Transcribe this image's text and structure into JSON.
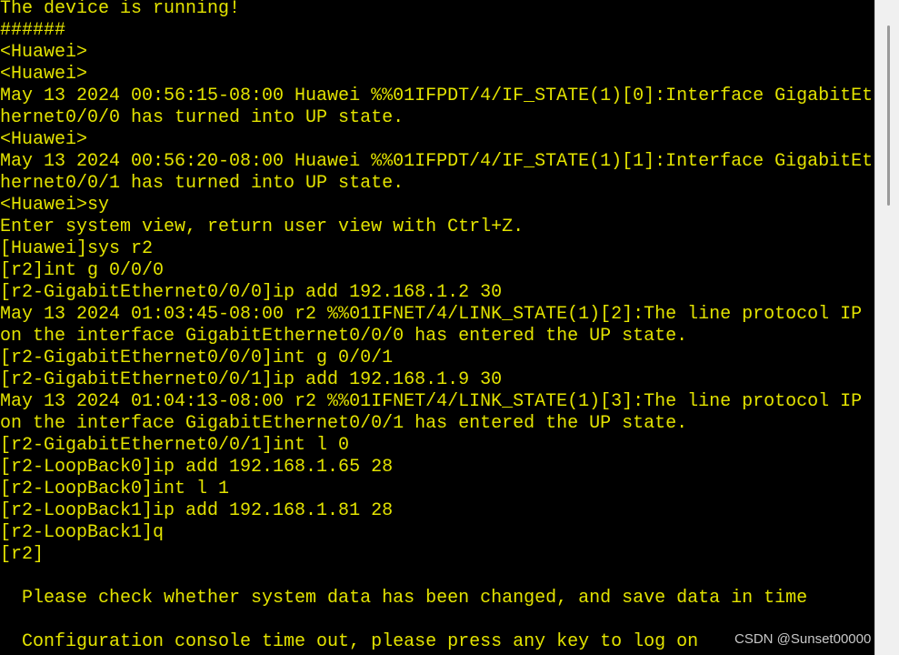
{
  "terminal": {
    "lines": [
      "The device is running!",
      "######",
      "<Huawei>",
      "<Huawei>",
      "May 13 2024 00:56:15-08:00 Huawei %%01IFPDT/4/IF_STATE(1)[0]:Interface GigabitEt",
      "hernet0/0/0 has turned into UP state.",
      "<Huawei>",
      "May 13 2024 00:56:20-08:00 Huawei %%01IFPDT/4/IF_STATE(1)[1]:Interface GigabitEt",
      "hernet0/0/1 has turned into UP state.",
      "<Huawei>sy",
      "Enter system view, return user view with Ctrl+Z.",
      "[Huawei]sys r2",
      "[r2]int g 0/0/0",
      "[r2-GigabitEthernet0/0/0]ip add 192.168.1.2 30",
      "May 13 2024 01:03:45-08:00 r2 %%01IFNET/4/LINK_STATE(1)[2]:The line protocol IP",
      "on the interface GigabitEthernet0/0/0 has entered the UP state.",
      "[r2-GigabitEthernet0/0/0]int g 0/0/1",
      "[r2-GigabitEthernet0/0/1]ip add 192.168.1.9 30",
      "May 13 2024 01:04:13-08:00 r2 %%01IFNET/4/LINK_STATE(1)[3]:The line protocol IP",
      "on the interface GigabitEthernet0/0/1 has entered the UP state.",
      "[r2-GigabitEthernet0/0/1]int l 0",
      "[r2-LoopBack0]ip add 192.168.1.65 28",
      "[r2-LoopBack0]int l 1",
      "[r2-LoopBack1]ip add 192.168.1.81 28",
      "[r2-LoopBack1]q",
      "[r2]",
      "",
      "  Please check whether system data has been changed, and save data in time",
      "",
      "  Configuration console time out, please press any key to log on"
    ],
    "text_color": "#e3e300",
    "background": "#000000"
  },
  "watermark": "CSDN @Sunset00000"
}
